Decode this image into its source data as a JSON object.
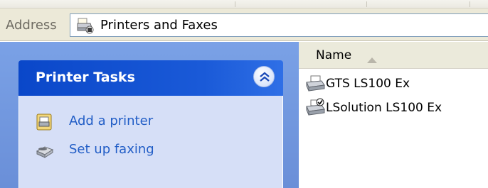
{
  "address_bar": {
    "label": "Address",
    "value": "Printers and Faxes",
    "icon": "printers-folder-icon"
  },
  "task_pane": {
    "title": "Printer Tasks",
    "collapse_icon": "chevron-up-double-icon",
    "items": [
      {
        "label": "Add a printer",
        "icon": "add-printer-icon"
      },
      {
        "label": "Set up faxing",
        "icon": "fax-icon"
      }
    ]
  },
  "file_list": {
    "column_header": "Name",
    "sort_direction": "ascending",
    "items": [
      {
        "label": "GTS LS100 Ex",
        "icon": "printer-icon",
        "default": false
      },
      {
        "label": "LSolution LS100 Ex",
        "icon": "default-printer-icon",
        "default": true
      }
    ]
  },
  "colors": {
    "task_header": "#0a47c9",
    "task_pane_bg": "#7aa1e6",
    "task_body_bg": "#d6dff7",
    "link_blue": "#215dc6",
    "address_bg": "#ece9d8"
  }
}
